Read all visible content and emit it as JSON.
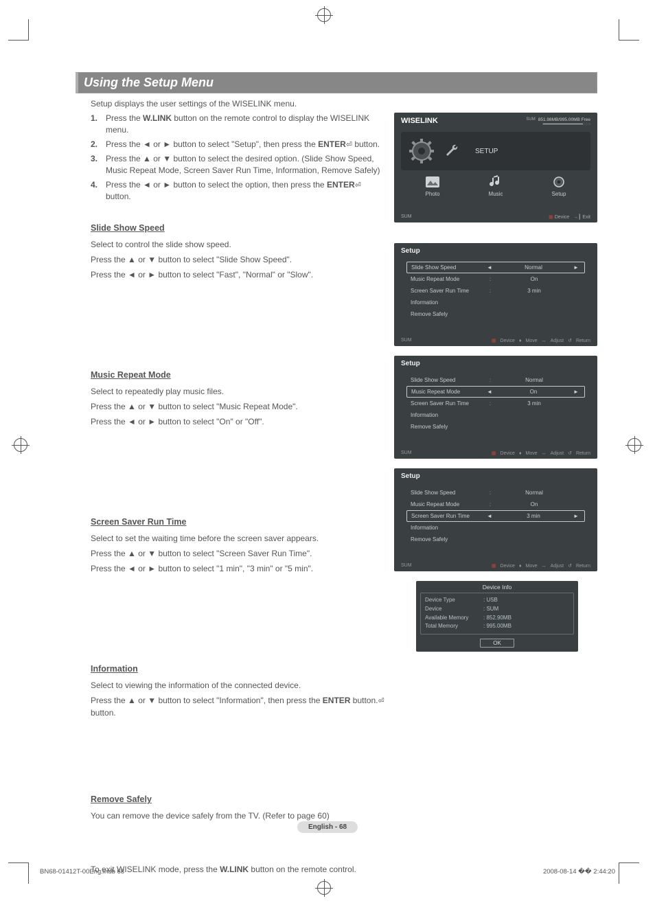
{
  "title": "Using the Setup Menu",
  "intro": "Setup displays the user settings of the WISELINK menu.",
  "steps": [
    {
      "num": "1.",
      "pre": "Press the ",
      "bold": "W.LINK",
      "post": " button on the remote control to display the WISELINK menu."
    },
    {
      "num": "2.",
      "pre": "Press the ◄ or ► button to select \"Setup\", then press the ",
      "bold": "ENTER",
      "post": " button.",
      "enter_icon": true
    },
    {
      "num": "3.",
      "pre": "Press the ▲ or ▼ button to select the desired option.",
      "bold": "",
      "post": " (Slide Show Speed, Music Repeat Mode, Screen Saver Run Time, Information, Remove Safely)"
    },
    {
      "num": "4.",
      "pre": "Press the ◄ or ► button to select the option, then press the ",
      "bold": "ENTER",
      "post": " button.",
      "enter_icon": true
    }
  ],
  "sections": [
    {
      "heading": "Slide Show Speed",
      "paras": [
        "Select to control the slide show speed.",
        "Press the ▲ or ▼ button to select \"Slide Show Speed\".",
        "Press the ◄ or ► button to select \"Fast\", \"Normal\" or \"Slow\"."
      ]
    },
    {
      "heading": "Music Repeat Mode",
      "paras": [
        "Select to repeatedly play music files.",
        "Press the ▲ or ▼ button to select \"Music Repeat Mode\".",
        "Press the ◄ or ► button to select \"On\" or \"Off\"."
      ]
    },
    {
      "heading": "Screen Saver Run Time",
      "paras": [
        "Select to set the waiting time before the screen saver appears.",
        "Press the ▲ or ▼ button to select \"Screen Saver Run Time\".",
        "Press the ◄ or ► button to select \"1 min\", \"3 min\" or \"5 min\"."
      ]
    },
    {
      "heading": "Information",
      "paras": [
        "Select to viewing the information of the connected device.",
        "Press the ▲ or ▼ button to select \"Information\", then press the ENTER ⏎ button."
      ]
    },
    {
      "heading": "Remove Safely",
      "paras": [
        "You can remove the device safely from the TV. (Refer to page 60)"
      ]
    }
  ],
  "exit_line_pre": "To exit WISELINK mode, press the ",
  "exit_line_bold": "W.LINK",
  "exit_line_post": " button on the remote control.",
  "wiselink": {
    "title": "WISELINK",
    "sum": "SUM",
    "mem": "851.98MB/995.00MB Free",
    "setup_label": "SETUP",
    "items": [
      "Photo",
      "Music",
      "Setup"
    ],
    "foot_l": "SUM",
    "foot_device": "Device",
    "foot_exit": "Exit"
  },
  "setup_screens": [
    {
      "title": "Setup",
      "rows": [
        {
          "label": "Slide Show Speed",
          "val": "Normal",
          "sel": true
        },
        {
          "label": "Music Repeat Mode",
          "val": "On"
        },
        {
          "label": "Screen Saver Run Time",
          "val": "3 min"
        },
        {
          "label": "Information",
          "val": ""
        },
        {
          "label": "Remove Safely",
          "val": ""
        }
      ]
    },
    {
      "title": "Setup",
      "rows": [
        {
          "label": "Slide Show Speed",
          "val": "Normal"
        },
        {
          "label": "Music Repeat Mode",
          "val": "On",
          "sel": true
        },
        {
          "label": "Screen Saver Run Time",
          "val": "3 min"
        },
        {
          "label": "Information",
          "val": ""
        },
        {
          "label": "Remove Safely",
          "val": ""
        }
      ]
    },
    {
      "title": "Setup",
      "rows": [
        {
          "label": "Slide Show Speed",
          "val": "Normal"
        },
        {
          "label": "Music Repeat Mode",
          "val": "On"
        },
        {
          "label": "Screen Saver Run Time",
          "val": "3 min",
          "sel": true
        },
        {
          "label": "Information",
          "val": ""
        },
        {
          "label": "Remove Safely",
          "val": ""
        }
      ]
    }
  ],
  "setup_foot": {
    "l": "SUM",
    "device": "Device",
    "move": "Move",
    "adjust": "Adjust",
    "return": "Return"
  },
  "devinfo": {
    "title": "Device Info",
    "rows": [
      {
        "k": "Device Type",
        "v": ": USB"
      },
      {
        "k": "Device",
        "v": ": SUM"
      },
      {
        "k": "Available Memory",
        "v": ": 852.90MB"
      },
      {
        "k": "Total Memory",
        "v": ": 995.00MB"
      }
    ],
    "ok": "OK"
  },
  "page_num": "English - 68",
  "footer_l": "BN68-01412T-00Eng.indb   68",
  "footer_r": "2008-08-14   �� 2:44:20"
}
